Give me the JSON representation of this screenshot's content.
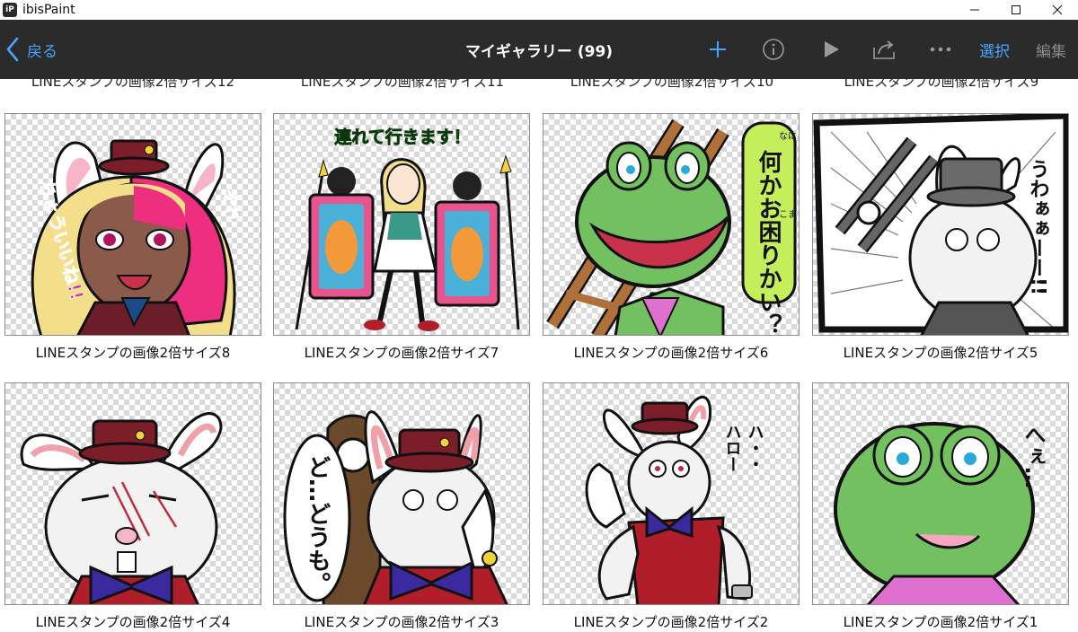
{
  "window": {
    "app_title": "ibisPaint",
    "app_icon_letters": "iP"
  },
  "toolbar": {
    "back_label": "戻る",
    "title": "マイギャラリー (99)",
    "select_label": "選択",
    "edit_label": "編集",
    "accent_color": "#4aa3ff"
  },
  "gallery": {
    "top_captions": [
      "LINEスタンプの画像2倍サイズ12",
      "LINEスタンプの画像2倍サイズ11",
      "LINEスタンプの画像2倍サイズ10",
      "LINEスタンプの画像2倍サイズ9"
    ],
    "row1": [
      {
        "caption": "LINEスタンプの画像2倍サイズ8",
        "text_a": "ちょういいね!!",
        "text_b": "それ"
      },
      {
        "caption": "LINEスタンプの画像2倍サイズ7",
        "text_a": "連れて行きます！"
      },
      {
        "caption": "LINEスタンプの画像2倍サイズ6",
        "text_a": "何かお困りかい？",
        "ruby_a": "なに",
        "ruby_b": "こま"
      },
      {
        "caption": "LINEスタンプの画像2倍サイズ5",
        "text_a": "うわぁぁーー!!"
      }
    ],
    "row2": [
      {
        "caption": "LINEスタンプの画像2倍サイズ4"
      },
      {
        "caption": "LINEスタンプの画像2倍サイズ3",
        "text_a": "ど…どうも。"
      },
      {
        "caption": "LINEスタンプの画像2倍サイズ2",
        "text_a": "ハ・・",
        "text_b": "ハロー"
      },
      {
        "caption": "LINEスタンプの画像2倍サイズ1",
        "text_a": "へぇ…"
      }
    ]
  }
}
